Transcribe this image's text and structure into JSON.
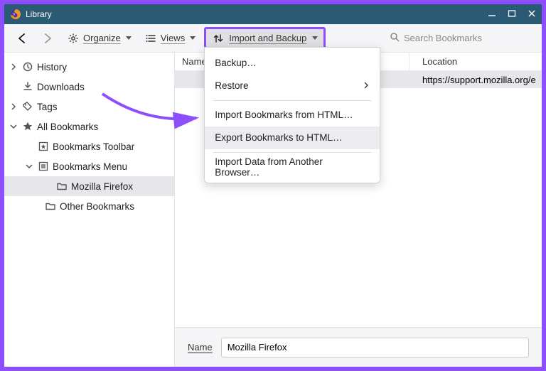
{
  "title": "Library",
  "toolbar": {
    "organize": "Organize",
    "views": "Views",
    "import_backup": "Import and Backup",
    "search_placeholder": "Search Bookmarks"
  },
  "menu": {
    "backup": "Backup…",
    "restore": "Restore",
    "import_html": "Import Bookmarks from HTML…",
    "export_html": "Export Bookmarks to HTML…",
    "import_browser": "Import Data from Another Browser…"
  },
  "sidebar": {
    "history": "History",
    "downloads": "Downloads",
    "tags": "Tags",
    "all_bookmarks": "All Bookmarks",
    "toolbar": "Bookmarks Toolbar",
    "menu": "Bookmarks Menu",
    "mozilla": "Mozilla Firefox",
    "other": "Other Bookmarks"
  },
  "columns": {
    "name": "Name",
    "location": "Location"
  },
  "row": {
    "location": "https://support.mozilla.org/e"
  },
  "details": {
    "label": "Name",
    "value": "Mozilla Firefox"
  }
}
